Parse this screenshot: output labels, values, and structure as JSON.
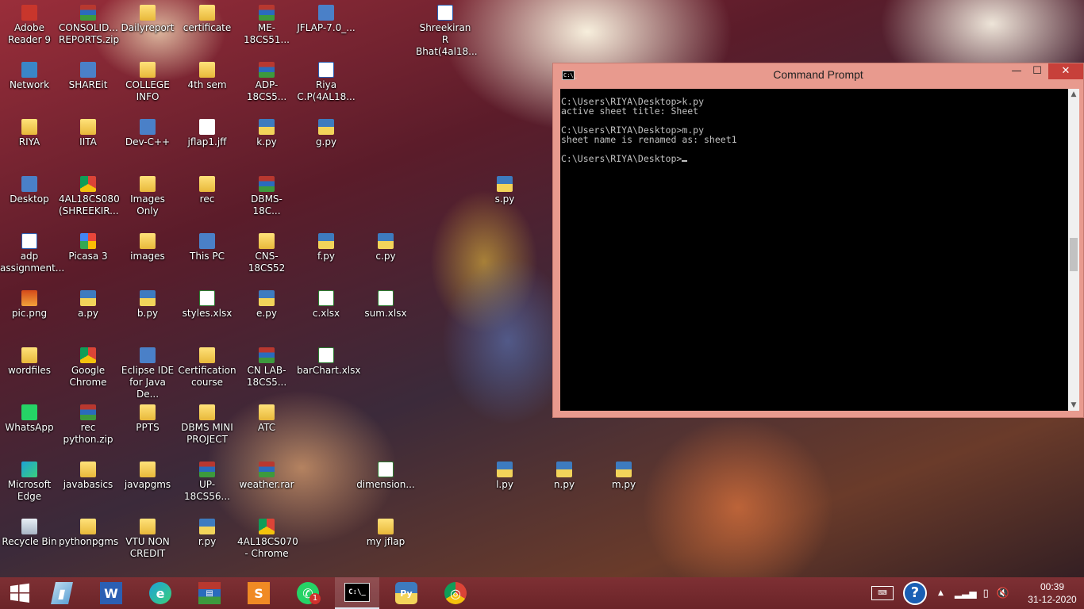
{
  "desktop": {
    "icons": [
      {
        "label": "Adobe Reader 9",
        "type": "redapp"
      },
      {
        "label": "CONSOLID... REPORTS.zip",
        "type": "rar"
      },
      {
        "label": "Dailyreport",
        "type": "folder"
      },
      {
        "label": "certificate",
        "type": "folder"
      },
      {
        "label": "ME-18CS51...",
        "type": "rar"
      },
      {
        "label": "JFLAP-7.0_...",
        "type": "app"
      },
      {
        "label": "Shreekiran R Bhat(4al18...",
        "type": "docx"
      },
      {
        "label": "Network",
        "type": "net"
      },
      {
        "label": "SHAREit",
        "type": "app"
      },
      {
        "label": "COLLEGE INFO",
        "type": "folder"
      },
      {
        "label": "4th sem",
        "type": "folder"
      },
      {
        "label": "ADP-18CS5...",
        "type": "rar"
      },
      {
        "label": "Riya C.P(4AL18...",
        "type": "docx"
      },
      {
        "label": "RIYA",
        "type": "folder"
      },
      {
        "label": "IITA",
        "type": "folder"
      },
      {
        "label": "Dev-C++",
        "type": "app"
      },
      {
        "label": "jflap1.jff",
        "type": "file"
      },
      {
        "label": "k.py",
        "type": "py"
      },
      {
        "label": "g.py",
        "type": "py"
      },
      {
        "label": "Desktop",
        "type": "app"
      },
      {
        "label": "4AL18CS080 (SHREEKIR...",
        "type": "chrome"
      },
      {
        "label": "Images Only",
        "type": "folder"
      },
      {
        "label": "rec",
        "type": "folder"
      },
      {
        "label": "DBMS-18C...",
        "type": "rar"
      },
      {
        "label": "s.py",
        "type": "py"
      },
      {
        "label": "adp assignment...",
        "type": "docx"
      },
      {
        "label": "Picasa 3",
        "type": "picasa"
      },
      {
        "label": "images",
        "type": "folder"
      },
      {
        "label": "This PC",
        "type": "app"
      },
      {
        "label": "CNS-18CS52",
        "type": "folder"
      },
      {
        "label": "f.py",
        "type": "py"
      },
      {
        "label": "c.py",
        "type": "py"
      },
      {
        "label": "pic.png",
        "type": "img"
      },
      {
        "label": "a.py",
        "type": "py"
      },
      {
        "label": "b.py",
        "type": "py"
      },
      {
        "label": "styles.xlsx",
        "type": "xlsx"
      },
      {
        "label": "e.py",
        "type": "py"
      },
      {
        "label": "c.xlsx",
        "type": "xlsx"
      },
      {
        "label": "sum.xlsx",
        "type": "xlsx"
      },
      {
        "label": "wordfiles",
        "type": "folder"
      },
      {
        "label": "Google Chrome",
        "type": "chrome"
      },
      {
        "label": "Eclipse IDE for Java De...",
        "type": "app"
      },
      {
        "label": "Certification course",
        "type": "folder"
      },
      {
        "label": "CN LAB-18CS5...",
        "type": "rar"
      },
      {
        "label": "barChart.xlsx",
        "type": "xlsx"
      },
      {
        "label": "WhatsApp",
        "type": "greenapp"
      },
      {
        "label": "rec python.zip",
        "type": "rar"
      },
      {
        "label": "PPTS",
        "type": "folder"
      },
      {
        "label": "DBMS MINI PROJECT",
        "type": "folder"
      },
      {
        "label": "ATC",
        "type": "folder"
      },
      {
        "label": "Microsoft Edge",
        "type": "edge"
      },
      {
        "label": "javabasics",
        "type": "folder"
      },
      {
        "label": "javapgms",
        "type": "folder"
      },
      {
        "label": "UP-18CS56...",
        "type": "rar"
      },
      {
        "label": "weather.rar",
        "type": "rar"
      },
      {
        "label": "dimension...",
        "type": "xlsx"
      },
      {
        "label": "l.py",
        "type": "py"
      },
      {
        "label": "n.py",
        "type": "py"
      },
      {
        "label": "m.py",
        "type": "py"
      },
      {
        "label": "Recycle Bin",
        "type": "bin"
      },
      {
        "label": "pythonpgms",
        "type": "folder"
      },
      {
        "label": "VTU NON CREDIT",
        "type": "folder"
      },
      {
        "label": "r.py",
        "type": "py"
      },
      {
        "label": "4AL18CS070 - Chrome",
        "type": "chrome"
      },
      {
        "label": "my jflap",
        "type": "folder"
      }
    ]
  },
  "cmd_window": {
    "title": "Command Prompt",
    "icon_text": "C:\\_",
    "minimize": "—",
    "maximize": "☐",
    "close": "✕",
    "lines": [
      "C:\\Users\\RIYA\\Desktop>k.py",
      "active sheet title: Sheet",
      "",
      "C:\\Users\\RIYA\\Desktop>m.py",
      "sheet name is renamed as: sheet1",
      "",
      "C:\\Users\\RIYA\\Desktop>"
    ]
  },
  "taskbar": {
    "start_label": "Start",
    "apps": [
      {
        "name": "file-manager",
        "glyph": "▮"
      },
      {
        "name": "word",
        "glyph": "W"
      },
      {
        "name": "edge",
        "glyph": "e"
      },
      {
        "name": "winrar",
        "glyph": "▤"
      },
      {
        "name": "sublime",
        "glyph": "S"
      },
      {
        "name": "whatsapp",
        "glyph": "✆",
        "badge": "1"
      },
      {
        "name": "command-prompt",
        "glyph": "C:\\_",
        "active": true
      },
      {
        "name": "python",
        "glyph": "Py"
      },
      {
        "name": "chrome",
        "glyph": "◎"
      }
    ],
    "time": "00:39",
    "date": "31-12-2020"
  },
  "colors": {
    "taskbar": "#7a2a2e",
    "cmd_frame": "#e89a8e",
    "console_bg": "#000000",
    "console_text": "#c0c0c0",
    "close_button": "#c7403a"
  }
}
